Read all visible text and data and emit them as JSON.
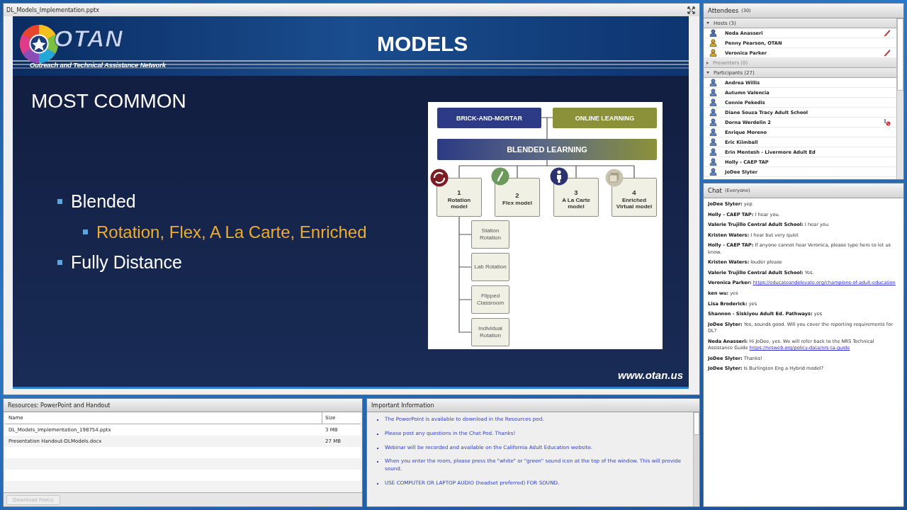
{
  "share_pod": {
    "title": "DL_Models_Implementation.pptx",
    "slide": {
      "logo_name": "OTAN",
      "logo_tagline": "Outreach and Technical Assistance Network",
      "heading": "MODELS",
      "title": "MOST COMMON",
      "bullets": [
        {
          "text": "Blended",
          "children": [
            {
              "text": "Rotation, Flex, A La Carte, Enriched"
            }
          ]
        },
        {
          "text": "Fully Distance"
        }
      ],
      "diagram": {
        "top": [
          "BRICK-AND-MORTAR",
          "ONLINE LEARNING"
        ],
        "center": "BLENDED LEARNING",
        "models": [
          {
            "number": "1",
            "name": "Rotation model"
          },
          {
            "number": "2",
            "name": "Flex model"
          },
          {
            "number": "3",
            "name": "A La Carte model"
          },
          {
            "number": "4",
            "name": "Enriched Virtual model"
          }
        ],
        "rotation_types": [
          "Station Rotation",
          "Lab Rotation",
          "Flipped Classroom",
          "Individual Rotation"
        ]
      },
      "footer": "www.otan.us"
    }
  },
  "resources": {
    "title": "Resources: PowerPoint and Handout",
    "columns": [
      "Name",
      "Size"
    ],
    "rows": [
      {
        "name": "DL_Models_Implementation_198754.pptx",
        "size": "3 MB"
      },
      {
        "name": "Presentation Handout-DLModels.docx",
        "size": "27 MB"
      }
    ],
    "download_button": {
      "label": "Download File(s)",
      "disabled": true
    }
  },
  "important_info": {
    "title": "Important Information",
    "items": [
      "The PowerPoint is available to download in the Resources pod.",
      "Please post any questions in the Chat Pod. Thanks!",
      "Webinar will be recorded and available on the California Adult Education website.",
      "When you enter the room, please press the \"white\" or \"green\" sound icon at the top of the window. This will provide sound.",
      "USE COMPUTER OR LAPTOP AUDIO (headset preferred) FOR SOUND."
    ]
  },
  "attendees": {
    "title": "Attendees",
    "count": "(30)",
    "groups": [
      {
        "label": "Hosts (3)",
        "expanded": true,
        "members": [
          {
            "name": "Neda Anasseri",
            "color": "#4a6fb5",
            "kind": "drawing"
          },
          {
            "name": "Penny Pearson, OTAN",
            "color": "#d9a520",
            "kind": "plain"
          },
          {
            "name": "Veronica Parker",
            "color": "#d9a520",
            "kind": "drawing"
          }
        ]
      },
      {
        "label": "Presenters (0)",
        "expanded": false
      },
      {
        "label": "Participants (27)",
        "expanded": true,
        "members": [
          {
            "name": "Andrea Willis",
            "color": "#5a82c8",
            "kind": "plain"
          },
          {
            "name": "Autumn Valencia",
            "color": "#5a82c8",
            "kind": "plain"
          },
          {
            "name": "Connie Pekedis",
            "color": "#5a82c8",
            "kind": "plain"
          },
          {
            "name": "Diane Souza Tracy Adult School",
            "color": "#5a82c8",
            "kind": "plain"
          },
          {
            "name": "Dorna Werdelin 2",
            "color": "#5a82c8",
            "kind": "phone"
          },
          {
            "name": "Enrique Moreno",
            "color": "#5a82c8",
            "kind": "plain"
          },
          {
            "name": "Eric Kiimball",
            "color": "#5a82c8",
            "kind": "plain"
          },
          {
            "name": "Erin Mentesh - Livermore Adult Ed",
            "color": "#5a82c8",
            "kind": "plain"
          },
          {
            "name": "Holly - CAEP TAP",
            "color": "#5a82c8",
            "kind": "plain"
          },
          {
            "name": "JoDee Slyter",
            "color": "#5a82c8",
            "kind": "plain"
          }
        ]
      }
    ]
  },
  "chat": {
    "title": "Chat",
    "audience": "(Everyone)",
    "messages": [
      {
        "sender": "JoDee Slyter:",
        "text": "yep"
      },
      {
        "sender": "Holly - CAEP TAP:",
        "text": "I hear you."
      },
      {
        "sender": "Valerie Trujillo Central Adult School:",
        "text": "I hear you"
      },
      {
        "sender": "Kristen Waters:",
        "text": "I hear but very quiet"
      },
      {
        "sender": "Holly - CAEP TAP:",
        "text": "If anyone cannot hear Veronica, please type here to let us know."
      },
      {
        "sender": "Kristen Waters:",
        "text": "louder please"
      },
      {
        "sender": "Valerie Trujillo Central Adult School:",
        "text": "Yes."
      },
      {
        "sender": "Veronica Parker:",
        "link": "https://educateandelevate.org/champions-of-adult-education"
      },
      {
        "sender": "ken wu:",
        "text": "yes"
      },
      {
        "sender": "Lisa Broderick:",
        "text": "yes"
      },
      {
        "sender": "Shannon - Siskiyou Adult Ed. Pathways:",
        "text": "yes"
      },
      {
        "sender": "JoDee Slyter:",
        "text": "Yes, sounds good.  Will you cover the reporting requirements for DL?"
      },
      {
        "sender": "Neda Anasseri:",
        "text": "Hi JoDee, yes. We will refer back to the NRS Technical Assistance Guide",
        "link": "https://nrsweb.org/policy-data/nrs-ta-guide"
      },
      {
        "sender": "JoDee Slyter:",
        "text": "Thanks!"
      },
      {
        "sender": "JoDee Slyter:",
        "text": "Is Burlington Eng a Hybrid model?"
      }
    ]
  }
}
